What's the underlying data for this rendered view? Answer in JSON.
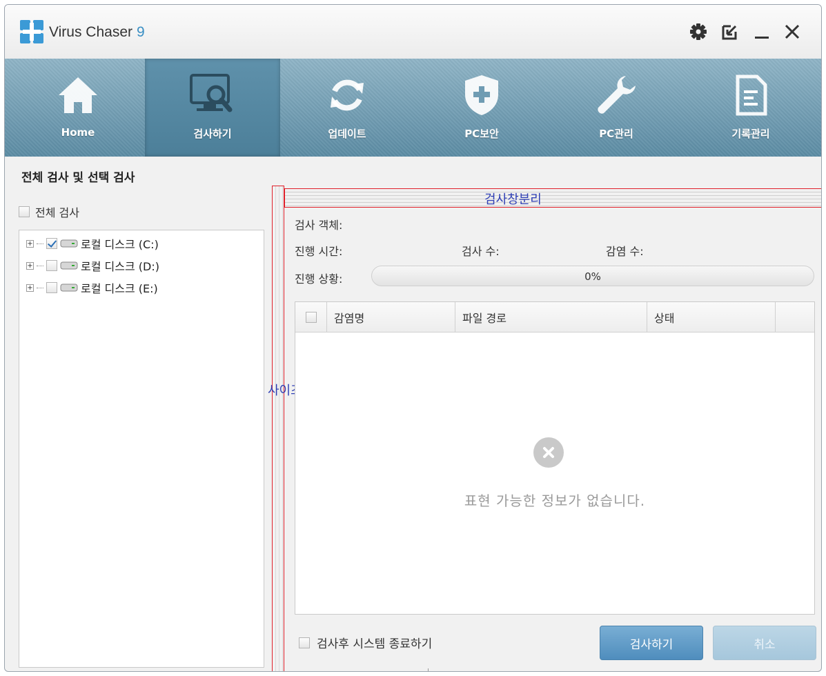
{
  "app": {
    "name": "Virus Chaser",
    "version": "9"
  },
  "nav": [
    {
      "label": "Home",
      "icon": "home-icon",
      "active": false
    },
    {
      "label": "검사하기",
      "icon": "scan-monitor-icon",
      "active": true
    },
    {
      "label": "업데이트",
      "icon": "refresh-icon",
      "active": false
    },
    {
      "label": "PC보안",
      "icon": "shield-plus-icon",
      "active": false
    },
    {
      "label": "PC관리",
      "icon": "wrench-icon",
      "active": false
    },
    {
      "label": "기록관리",
      "icon": "document-icon",
      "active": false
    }
  ],
  "section_title": "전체 검사 및 선택 검사",
  "full_scan_label": "전체 검사",
  "drives": [
    {
      "label": "로컬 디스크 (C:)",
      "checked": true
    },
    {
      "label": "로컬 디스크 (D:)",
      "checked": false
    },
    {
      "label": "로컬 디스크 (E:)",
      "checked": false
    }
  ],
  "annotations": {
    "detach": "검사창분리",
    "resize": "사이즈조절"
  },
  "scan_info": {
    "object_label": "검사 객체:",
    "time_label": "진행 시간:",
    "count_label": "검사 수:",
    "infected_label": "감염 수:",
    "status_label": "진행 상황:",
    "progress_text": "0%",
    "progress_value": 0
  },
  "table": {
    "columns": [
      "감염명",
      "파일 경로",
      "상태"
    ],
    "empty_message": "표현 가능한 정보가 없습니다."
  },
  "shutdown_label": "검사후 시스템 종료하기",
  "buttons": {
    "scan": "검사하기",
    "cancel": "취소"
  },
  "colors": {
    "accent": "#5c96bf",
    "nav_bg": "#5c8ca4",
    "annotation_text": "#2f3fb5",
    "annotation_border": "#e0202a"
  }
}
